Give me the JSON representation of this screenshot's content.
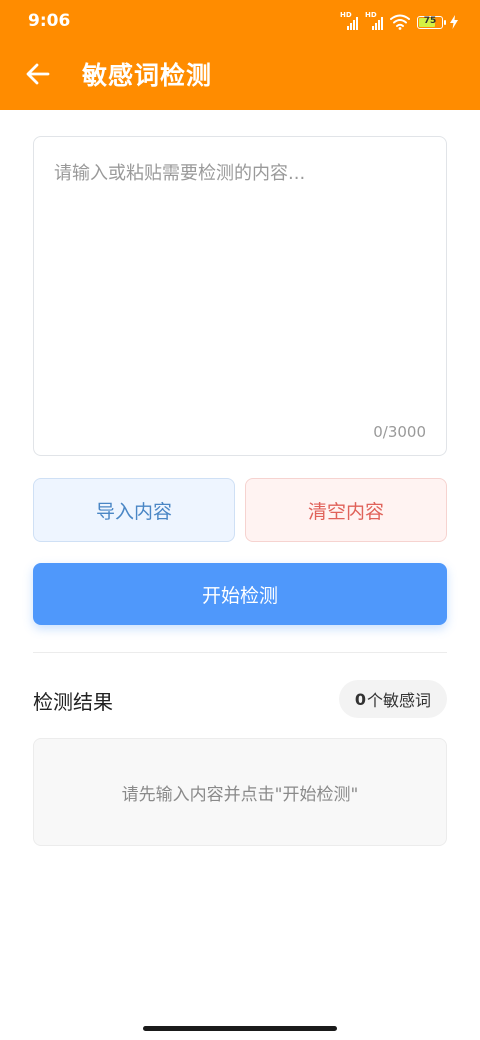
{
  "status_bar": {
    "time": "9:06",
    "signal1_label": "HD",
    "signal2_label": "HD",
    "battery_level": "75",
    "battery_fraction": 0.75
  },
  "toolbar": {
    "back_icon": "arrow-left-icon",
    "title": "敏感词检测",
    "color": "#ff8c00"
  },
  "input": {
    "value": "",
    "placeholder": "请输入或粘贴需要检测的内容...",
    "char_count": "0/3000"
  },
  "actions": {
    "import_label": "导入内容",
    "clear_label": "清空内容",
    "start_label": "开始检测",
    "start_color": "#4f98fb"
  },
  "results": {
    "title": "检测结果",
    "count": "0",
    "count_suffix": "个敏感词",
    "empty_message": "请先输入内容并点击\"开始检测\""
  }
}
